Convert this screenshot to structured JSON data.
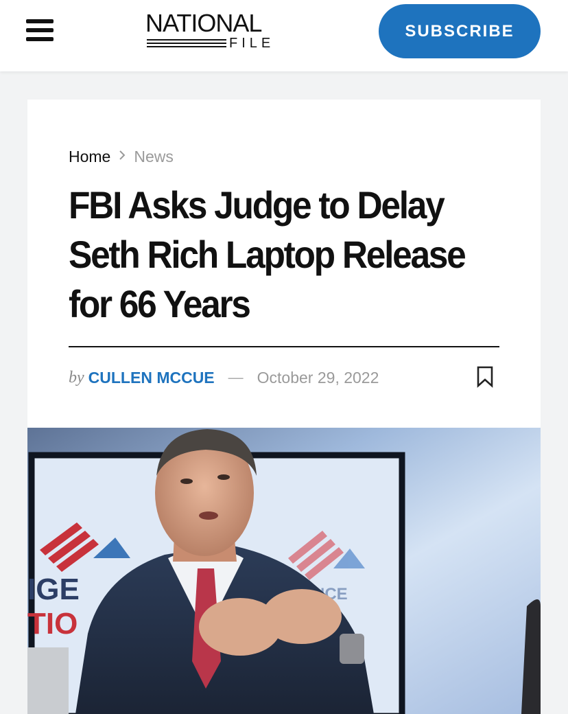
{
  "header": {
    "menu_icon": "hamburger-menu-icon",
    "logo_top": "NATIONAL",
    "logo_bottom": "FILE",
    "subscribe_label": "SUBSCRIBE",
    "accent_color": "#1e73be"
  },
  "breadcrumb": {
    "home": "Home",
    "separator_icon": "chevron-right-icon",
    "current": "News"
  },
  "article": {
    "title_line1": "FBI Asks Judge to Delay",
    "title_line2": "Seth Rich Laptop Release",
    "title_line3": "for 66 Years",
    "by": "by",
    "author": "CULLEN MCCUE",
    "separator": "—",
    "date": "October 29, 2022",
    "bookmark_icon": "bookmark-icon"
  },
  "hero": {
    "banner_text_left": "IGE\nTIO\nSU",
    "banner_text_right": "ENCE\nNAL\nSUMMIT"
  }
}
